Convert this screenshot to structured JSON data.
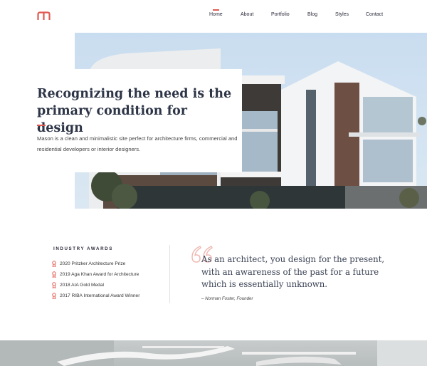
{
  "header": {
    "logo_icon": "mason-logo-icon",
    "nav": [
      {
        "label": "Home",
        "active": true
      },
      {
        "label": "About",
        "active": false
      },
      {
        "label": "Portfolio",
        "active": false
      },
      {
        "label": "Blog",
        "active": false
      },
      {
        "label": "Styles",
        "active": false
      },
      {
        "label": "Contact",
        "active": false
      }
    ]
  },
  "hero": {
    "title": "Recognizing the need is the primary condition for design",
    "description": "Mason is a clean and minimalistic site perfect for architecture firms, commercial and residential developers or interior designers.",
    "image": "modern-house-photo"
  },
  "awards": {
    "title": "INDUSTRY AWARDS",
    "icon": "award-ribbon-icon",
    "items": [
      "2020 Pritzker Architecture Prize",
      "2019 Aga Khan Award for Architecture",
      "2018 AIA Gold Medal",
      "2017 RIBA International Award Winner"
    ]
  },
  "quote": {
    "text": "As an architect, you design for the present, with an awareness of the past for a future which is essentially unknown.",
    "author": "– Norman Foster, Founder"
  },
  "bottom": {
    "image": "interior-ceiling-photo"
  },
  "colors": {
    "accent": "#e05a50",
    "heading": "#2d3547",
    "body_text": "#444444",
    "background": "#ffffff"
  }
}
